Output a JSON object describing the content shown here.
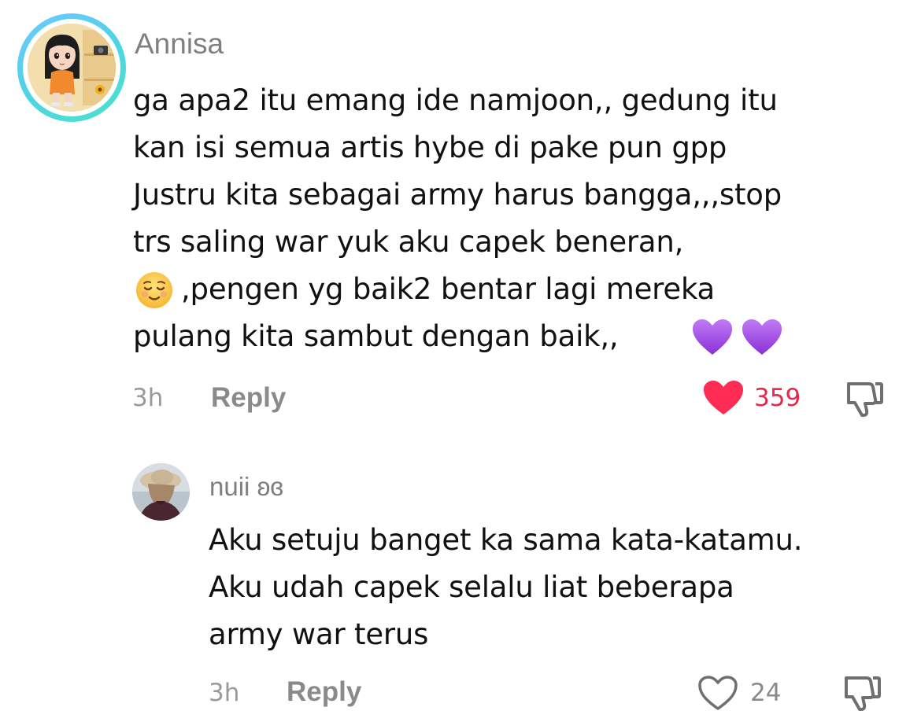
{
  "comment": {
    "username": "Annisa",
    "lines": [
      "ga apa2 itu emang ide namjoon,, gedung itu",
      "kan isi semua artis hybe di pake pun gpp",
      "Justru kita sebagai army harus bangga,,,stop",
      "trs saling war yuk aku capek beneran,",
      ",pengen yg baik2 bentar lagi mereka",
      "pulang kita sambut dengan baik,,"
    ],
    "time": "3h",
    "reply_label": "Reply",
    "like_count": "359",
    "liked": true,
    "emojis": [
      "relieved-face-emoji",
      "purple-heart-emoji",
      "purple-heart-emoji"
    ]
  },
  "reply": {
    "username": "nuii ʚɞ",
    "lines": [
      "Aku setuju banget ka sama kata-katamu.",
      "Aku udah capek selalu liat beberapa",
      "army war terus"
    ],
    "time": "3h",
    "reply_label": "Reply",
    "like_count": "24",
    "liked": false
  },
  "colors": {
    "like_active": "#fe2c55",
    "like_count_active": "#e5284c",
    "muted": "#8a8a8a",
    "avatar_ring_start": "#6ec8ff",
    "avatar_ring_end": "#4be3c9",
    "purple_heart": "#a24fe0"
  }
}
